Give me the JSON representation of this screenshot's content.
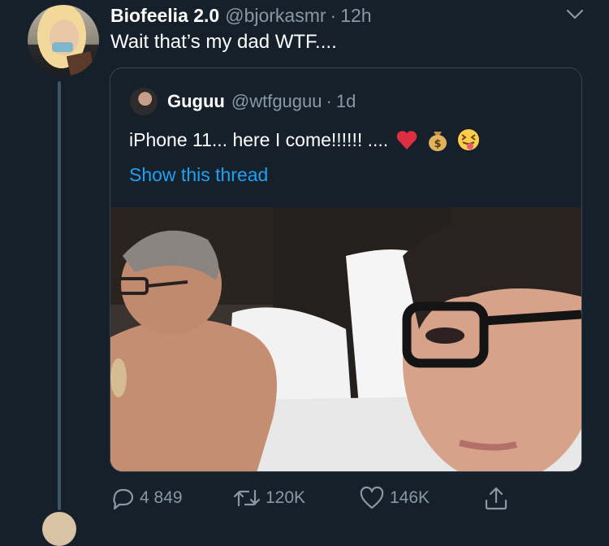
{
  "tweet": {
    "display_name": "Biofeelia 2.0",
    "handle": "@bjorkasmr",
    "separator": "·",
    "time": "12h",
    "text": "Wait that’s my dad WTF...."
  },
  "quoted_tweet": {
    "display_name": "Guguu",
    "handle": "@wtfguguu",
    "separator": "·",
    "time": "1d",
    "text": "iPhone 11... here I come!!!!!!  ....",
    "emojis": [
      "heart-emoji",
      "money-bag-emoji",
      "squinting-tongue-emoji"
    ],
    "show_thread": "Show this thread"
  },
  "actions": {
    "replies": "4 849",
    "retweets": "120K",
    "likes": "146K"
  },
  "colors": {
    "background": "#15202b",
    "secondary_text": "#8899a6",
    "link": "#1da1f2",
    "border": "#38444d"
  }
}
